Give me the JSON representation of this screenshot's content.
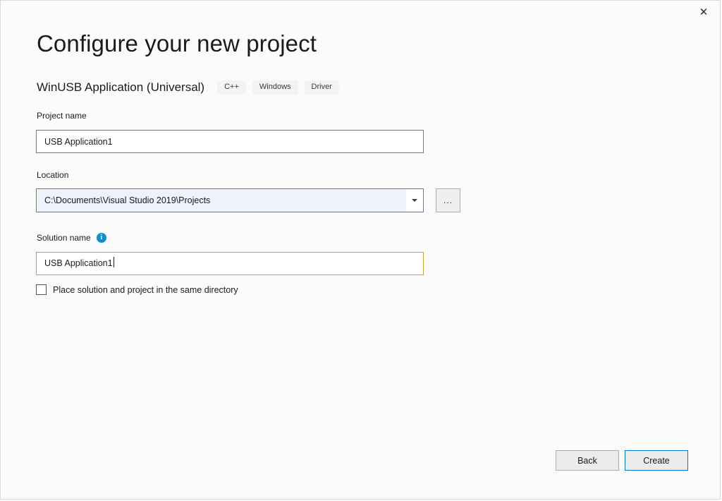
{
  "window": {
    "close_label": "✕"
  },
  "header": {
    "title": "Configure your new project",
    "template_name": "WinUSB Application (Universal)",
    "tags": [
      "C++",
      "Windows",
      "Driver"
    ]
  },
  "form": {
    "project_name": {
      "label": "Project name",
      "value": "USB Application1"
    },
    "location": {
      "label": "Location",
      "value": "C:\\Documents\\Visual Studio 2019\\Projects",
      "browse_label": "..."
    },
    "solution_name": {
      "label": "Solution name",
      "value": "USB Application1",
      "info_glyph": "i"
    },
    "same_directory_checkbox": {
      "label": "Place solution and project in the same directory",
      "checked": false
    }
  },
  "footer": {
    "back_label": "Back",
    "create_label": "Create"
  },
  "colors": {
    "accent_blue": "#0078d7",
    "info_blue": "#0b8fd6",
    "focus_gold": "#c9a227",
    "combo_fill": "#eef2fb",
    "dialog_bg": "#fbfbfb"
  }
}
